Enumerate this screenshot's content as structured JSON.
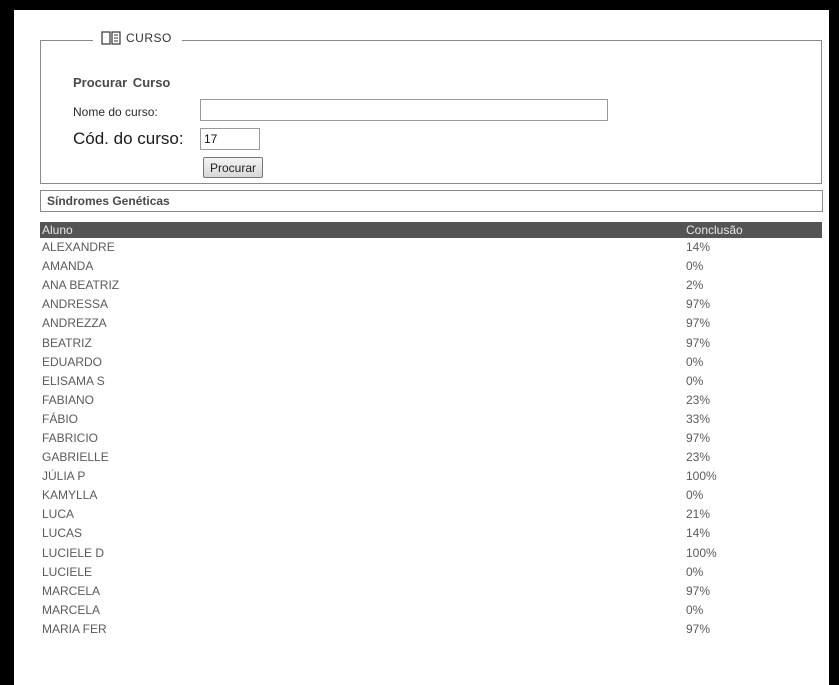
{
  "search_box": {
    "legend": "CURSO",
    "title": "Procurar  Curso",
    "name_label": "Nome do curso:",
    "name_value": "",
    "code_label": "Cód. do curso:",
    "code_value": "17",
    "search_button": "Procurar"
  },
  "results": {
    "course_title": "Síndromes Genéticas",
    "columns": [
      "Aluno",
      "Conclusão"
    ],
    "rows": [
      {
        "aluno": "ALEXANDRE",
        "conclusao": "14%"
      },
      {
        "aluno": "AMANDA",
        "conclusao": "0%"
      },
      {
        "aluno": "ANA BEATRIZ",
        "conclusao": "2%"
      },
      {
        "aluno": "ANDRESSA",
        "conclusao": "97%"
      },
      {
        "aluno": "ANDREZZA",
        "conclusao": "97%"
      },
      {
        "aluno": "BEATRIZ",
        "conclusao": "97%"
      },
      {
        "aluno": "EDUARDO",
        "conclusao": "0%"
      },
      {
        "aluno": "ELISAMA S",
        "conclusao": "0%"
      },
      {
        "aluno": "FABIANO",
        "conclusao": "23%"
      },
      {
        "aluno": "FÁBIO",
        "conclusao": "33%"
      },
      {
        "aluno": "FABRICIO",
        "conclusao": "97%"
      },
      {
        "aluno": "GABRIELLE",
        "conclusao": "23%"
      },
      {
        "aluno": "JÚLIA P",
        "conclusao": "100%"
      },
      {
        "aluno": "KAMYLLA",
        "conclusao": "0%"
      },
      {
        "aluno": "LUCA",
        "conclusao": "21%"
      },
      {
        "aluno": "LUCAS",
        "conclusao": "14%"
      },
      {
        "aluno": "LUCIELE D",
        "conclusao": "100%"
      },
      {
        "aluno": "LUCIELE",
        "conclusao": "0%"
      },
      {
        "aluno": "MARCELA",
        "conclusao": "97%"
      },
      {
        "aluno": "MARCELA",
        "conclusao": "0%"
      },
      {
        "aluno": "MARIA FER",
        "conclusao": "97%"
      }
    ]
  }
}
